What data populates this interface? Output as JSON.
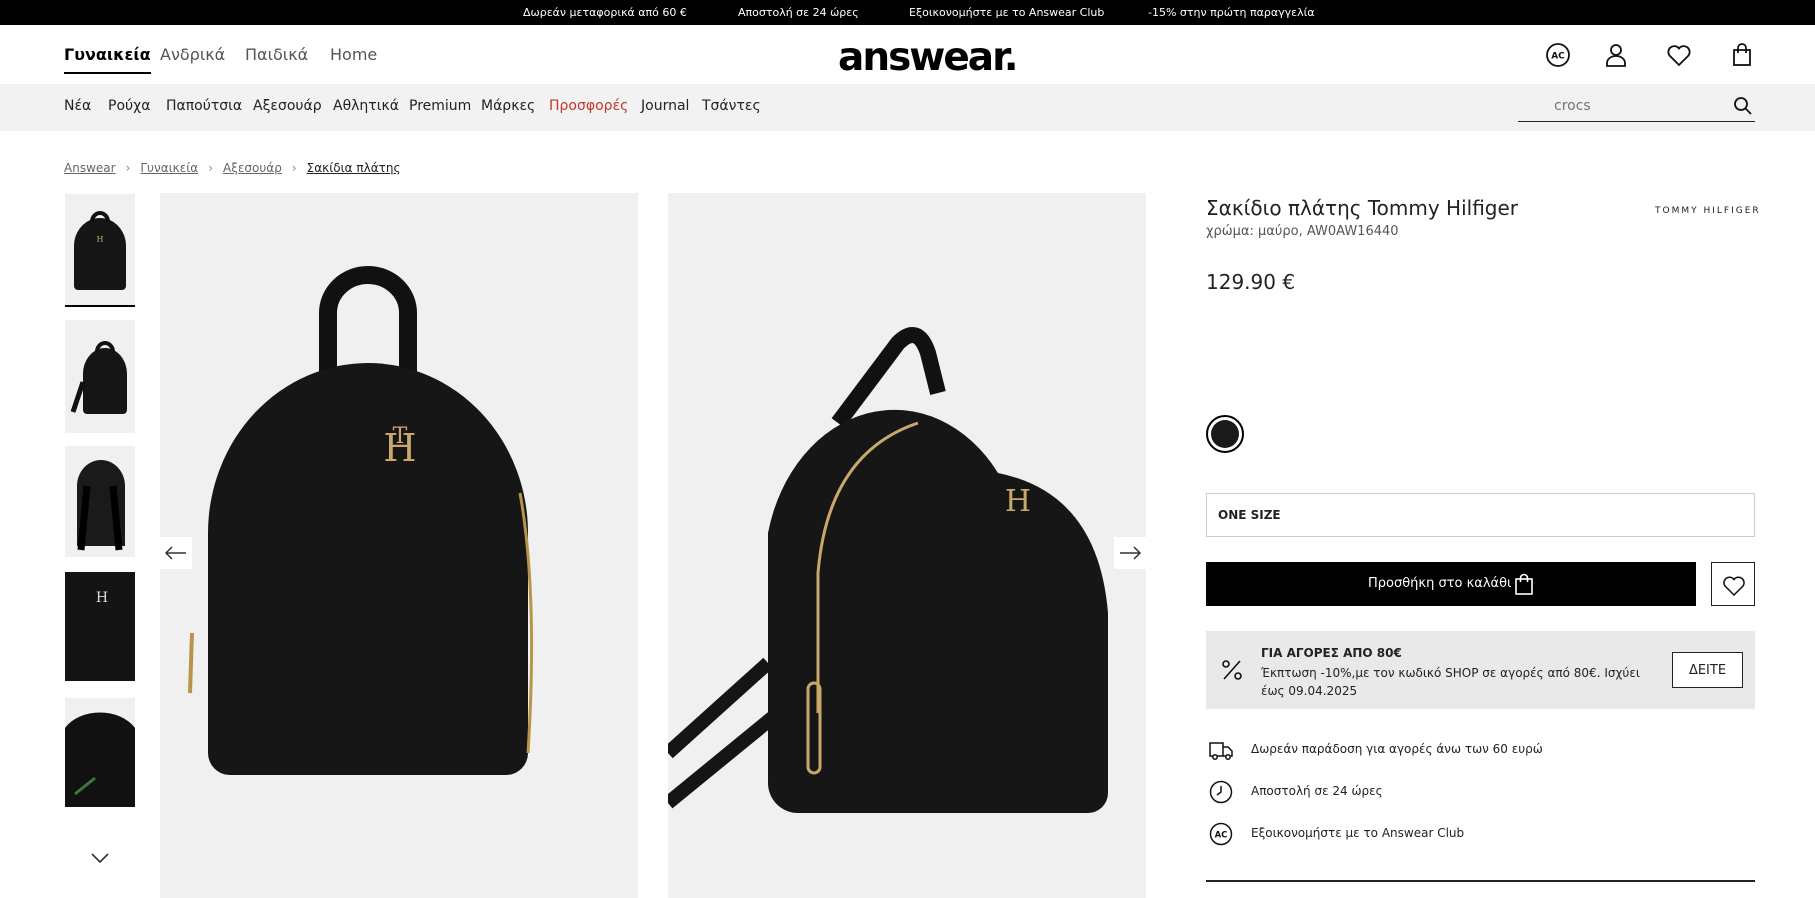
{
  "promo_bar": {
    "items": [
      "Δωρεάν μεταφορικά από 60 €",
      "Αποστολή σε 24 ώρες",
      "Εξοικονομήστε με το Answear Club",
      "-15% στην πρώτη παραγγελία"
    ]
  },
  "header": {
    "genders": [
      "Γυναικεία",
      "Ανδρικά",
      "Παιδικά",
      "Home"
    ],
    "logo": "answear.",
    "icons": [
      "ac-club-icon",
      "user-icon",
      "heart-icon",
      "bag-icon"
    ]
  },
  "categories": {
    "items": [
      "Νέα",
      "Ρούχα",
      "Παπούτσια",
      "Αξεσουάρ",
      "Αθλητικά",
      "Premium",
      "Μάρκες",
      "Προσφορές",
      "Journal",
      "Τσάντες"
    ],
    "highlight_color": "#c0392b"
  },
  "search": {
    "placeholder": "crocs"
  },
  "breadcrumb": [
    "Answear",
    "Γυναικεία",
    "Αξεσουάρ",
    "Σακίδια πλάτης"
  ],
  "gallery": {
    "thumbnail_count": 5,
    "active_thumbnail": 1
  },
  "product": {
    "title": "Σακίδιο πλάτης Tommy Hilfiger",
    "subtitle": "χρώμα: μαύρο, AW0AW16440",
    "brand_logo": "TOMMY HILFIGER",
    "price": "129.90 €",
    "color_swatch": "#1a1a1a",
    "size": "ONE SIZE",
    "add_to_cart": "Προσθήκη στο καλάθι"
  },
  "promo_box": {
    "title": "ΓΙΑ ΑΓΟΡΕΣ ΑΠΟ 80€",
    "text": "Έκπτωση -10%,με τον κωδικό SHOP σε αγορές από 80€. Ισχύει έως 09.04.2025",
    "button": "ΔΕΙΤΕ"
  },
  "benefits": [
    {
      "icon": "delivery-truck-icon",
      "text": "Δωρεάν παράδοση για αγορές άνω των 60 ευρώ"
    },
    {
      "icon": "clock-icon",
      "text": "Αποστολή σε 24 ώρες"
    },
    {
      "icon": "ac-club-icon",
      "text": "Εξοικονομήστε με το Answear Club"
    }
  ]
}
